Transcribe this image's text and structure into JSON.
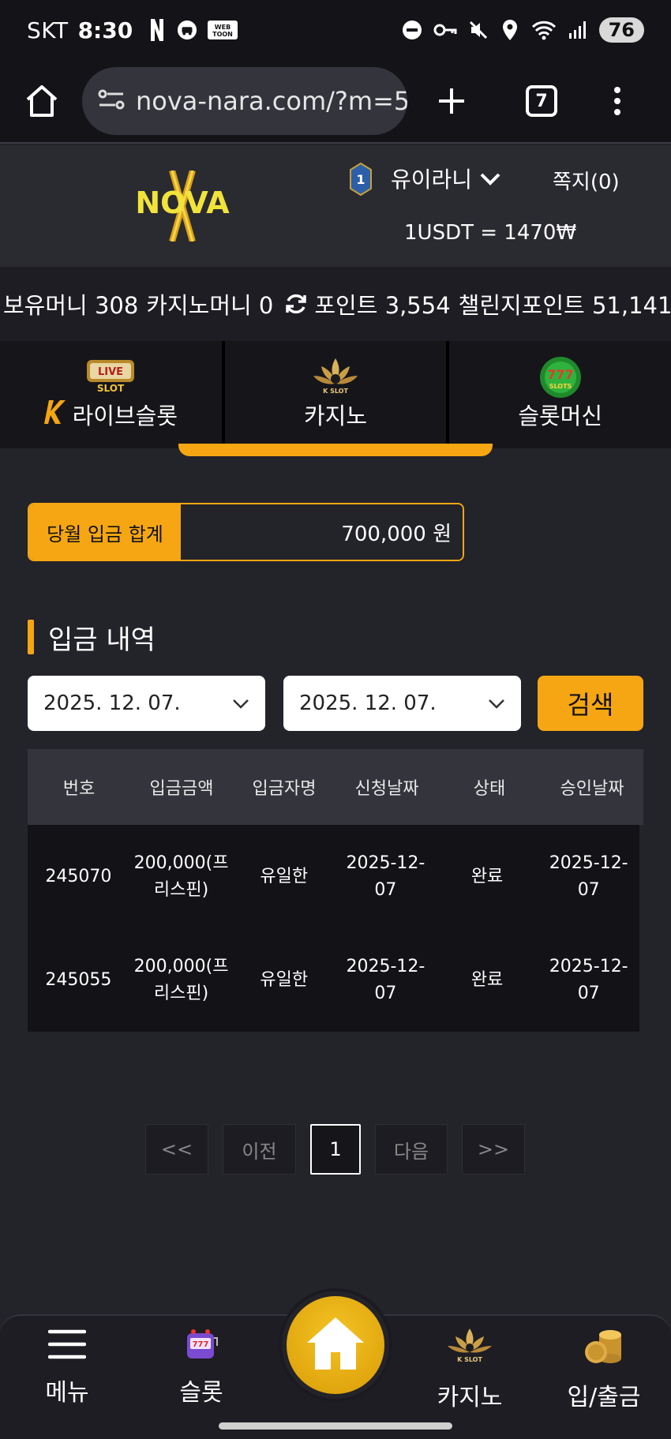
{
  "status_bar": {
    "carrier": "SKT",
    "time": "8:30",
    "app_icons": [
      "netflix-icon",
      "car-icon",
      "webtoon-icon"
    ],
    "webtoon_label": "WEB TOON",
    "system_icons": [
      "dnd-icon",
      "key-icon",
      "mute-icon",
      "location-icon",
      "wifi-icon",
      "signal-icon"
    ],
    "battery": "76"
  },
  "browser": {
    "url": "nova-nara.com/?m=5",
    "tab_count": "7"
  },
  "header": {
    "logo_text": "NOVA",
    "level": "1",
    "username": "유이라니",
    "messages": "쪽지(0)",
    "exchange_rate": "1USDT = 1470₩"
  },
  "balances": {
    "money": "보유머니 308",
    "casino_money": "카지노머니 0",
    "points": "포인트 3,554",
    "challenge_points": "챌린지포인트 51,141"
  },
  "game_tabs": [
    {
      "label": "라이브슬롯",
      "icon": "live-slot-icon",
      "icon_text": "LIVE SLOT"
    },
    {
      "label": "카지노",
      "icon": "k-slot-icon",
      "icon_text": "K SLOT"
    },
    {
      "label": "슬롯머신",
      "icon": "slots-777-icon",
      "icon_text": "777 SLOTS"
    }
  ],
  "monthly_total": {
    "label": "당월 입금 합계",
    "value": "700,000 원"
  },
  "section_title": "입금 내역",
  "filters": {
    "start_date": "2025. 12. 07.",
    "end_date": "2025. 12. 07.",
    "search_label": "검색"
  },
  "table": {
    "headers": [
      "번호",
      "입금금액",
      "입금자명",
      "신청날짜",
      "상태",
      "승인날짜"
    ],
    "rows": [
      [
        "245070",
        "200,000(프리스핀)",
        "유일한",
        "2025-12-07",
        "완료",
        "2025-12-07"
      ],
      [
        "245055",
        "200,000(프리스핀)",
        "유일한",
        "2025-12-07",
        "완료",
        "2025-12-07"
      ]
    ]
  },
  "pagination": {
    "first": "<<",
    "prev": "이전",
    "current": "1",
    "next": "다음",
    "last": ">>"
  },
  "bottom_nav": {
    "menu": "메뉴",
    "slot": "슬롯",
    "casino": "카지노",
    "cash": "입/출금"
  },
  "colors": {
    "accent": "#f5a612",
    "background": "#23232a"
  }
}
